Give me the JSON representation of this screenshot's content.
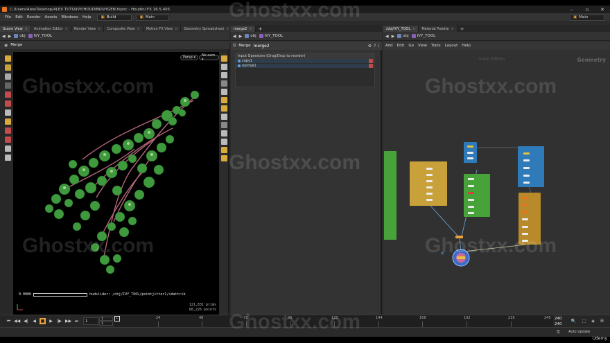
{
  "window": {
    "title": "C:/Users/Alex/Desktop/ALEX TUTO/IVY/HOUDINI/IVYGEN.hipnc - Houdini FX 16.5.405",
    "controls": [
      "–",
      "▫",
      "✕"
    ]
  },
  "menubar": {
    "items": [
      "File",
      "Edit",
      "Render",
      "Assets",
      "Windows",
      "Help"
    ],
    "build_label": "Build",
    "desk_label": "Main",
    "right_desk_label": "Main"
  },
  "scene_pane": {
    "tabs": [
      "Scene View",
      "Animation Editor",
      "Render View",
      "Composite View",
      "Motion FX View",
      "Geometry Spreadsheet"
    ],
    "path": {
      "root": "obj",
      "node": "IVY_TOOL"
    },
    "header_label": "Merge",
    "persp_button": "Persp ▾",
    "cam_button": "No cam ▾",
    "hud_value": "0.0000",
    "hud_text": "hudslider: /obj/IVY_TOOL/pointjitter1/idattrib",
    "stats": {
      "prims": "121,831  prims",
      "points": "68,226  points"
    }
  },
  "param_pane": {
    "tabs": [
      "merge2"
    ],
    "path": {
      "root": "obj",
      "node": "IVY_TOOL"
    },
    "node_type": "Merge",
    "node_name": "merge2",
    "input_title": "Input Operators (Drag/Drop to reorder)",
    "inputs": [
      "copy1",
      "normal1"
    ]
  },
  "net_pane": {
    "tabs": [
      "/obj/IVY_TOOL",
      "Material Palette"
    ],
    "path": {
      "root": "obj",
      "node": "IVY_TOOL"
    },
    "menu": [
      "Add",
      "Edit",
      "Go",
      "View",
      "Tools",
      "Layout",
      "Help"
    ],
    "indie_label": "Indie Edition",
    "context_label": "Geometry"
  },
  "playbar": {
    "current_frame": "1",
    "start_frame": "1",
    "start_frame_2": "1",
    "ticks": [
      "1",
      "24",
      "48",
      "72",
      "96",
      "120",
      "144",
      "168",
      "192",
      "216",
      "240"
    ],
    "end_frame": "240",
    "end_frame_2": "240"
  },
  "status": {
    "auto_update": "Auto Update",
    "udemy": "Udemy"
  },
  "watermark": "Ghostxx.com",
  "colors": {
    "accent_orange": "#e8731c",
    "node_yellow": "#c8a13a",
    "node_green": "#47a23a",
    "node_blue": "#2f7ab8",
    "node_gold": "#b88a2a"
  }
}
